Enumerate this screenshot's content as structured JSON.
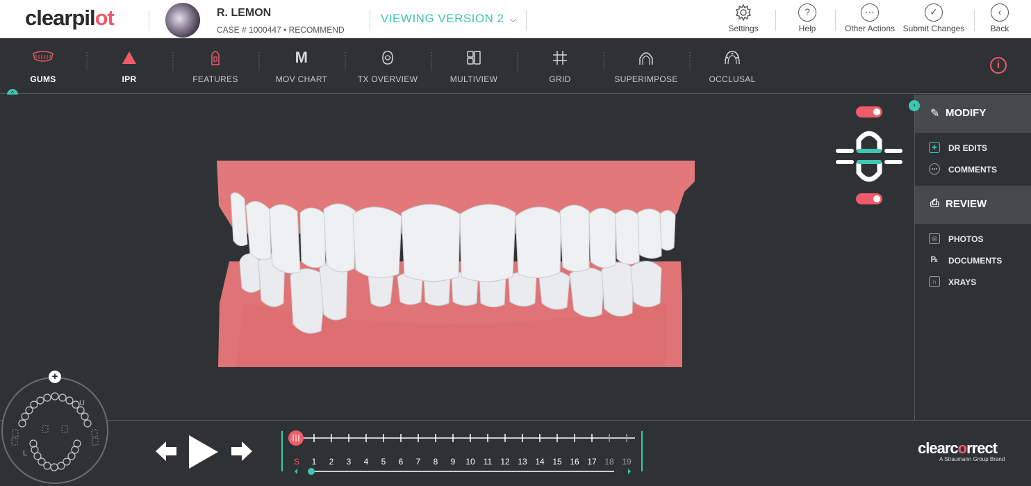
{
  "header": {
    "logo_text_a": "clearpil",
    "logo_text_b": "ot",
    "patient_name": "R. LEMON",
    "case_line": "CASE # 1000447 • RECOMMEND",
    "version_label": "VIEWING VERSION 2",
    "actions": [
      {
        "label": "Settings",
        "icon": "gear-icon"
      },
      {
        "label": "Help",
        "icon": "help-icon"
      },
      {
        "label": "Other Actions",
        "icon": "more-icon"
      },
      {
        "label": "Submit Changes",
        "icon": "check-icon"
      },
      {
        "label": "Back",
        "icon": "back-icon"
      }
    ]
  },
  "toolbar": {
    "tools": [
      {
        "label": "GUMS",
        "icon": "gums-icon",
        "active": true
      },
      {
        "label": "IPR",
        "icon": "ipr-triangle-icon",
        "active": true
      },
      {
        "label": "FEATURES",
        "icon": "features-icon",
        "active": false
      },
      {
        "label": "MOV CHART",
        "icon": "mov-chart-icon",
        "active": false
      },
      {
        "label": "TX OVERVIEW",
        "icon": "tx-overview-icon",
        "active": false
      },
      {
        "label": "MULTIVIEW",
        "icon": "multiview-icon",
        "active": false
      },
      {
        "label": "GRID",
        "icon": "grid-icon",
        "active": false
      },
      {
        "label": "SUPERIMPOSE",
        "icon": "superimpose-icon",
        "active": false
      },
      {
        "label": "OCCLUSAL",
        "icon": "occlusal-icon",
        "active": false
      }
    ],
    "mov_chart_glyph": "M"
  },
  "sidepanel": {
    "modify_label": "MODIFY",
    "modify_items": [
      {
        "label": "DR EDITS",
        "icon": "dr-edits-icon"
      },
      {
        "label": "COMMENTS",
        "icon": "comments-icon"
      }
    ],
    "review_label": "REVIEW",
    "review_items": [
      {
        "label": "PHOTOS",
        "icon": "photo-icon"
      },
      {
        "label": "DOCUMENTS",
        "icon": "rx-icon"
      },
      {
        "label": "XRAYS",
        "icon": "xray-icon"
      }
    ]
  },
  "arch": {
    "upper_label": "U",
    "lower_label": "L",
    "plus_label": "+"
  },
  "timeline": {
    "start_label": "S",
    "steps": [
      "1",
      "2",
      "3",
      "4",
      "5",
      "6",
      "7",
      "8",
      "9",
      "10",
      "11",
      "12",
      "13",
      "14",
      "15",
      "16",
      "17",
      "18",
      "19"
    ],
    "dim_steps": [
      "18",
      "19"
    ],
    "current_step": 0
  },
  "brand": {
    "name_a": "clearc",
    "name_o": "o",
    "name_b": "rrect",
    "tagline": "A Straumann Group Brand"
  },
  "colors": {
    "accent_teal": "#3ec6b3",
    "accent_pink": "#ef5b6a",
    "gum": "#e2787a",
    "tooth": "#eef0f2"
  }
}
